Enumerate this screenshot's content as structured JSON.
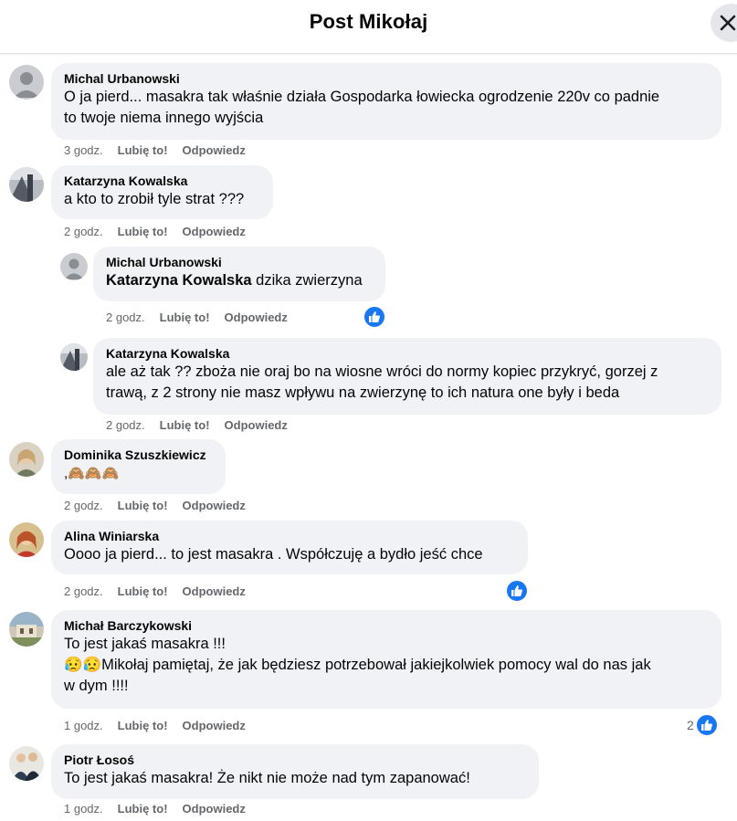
{
  "header": {
    "title": "Post Mikołaj"
  },
  "actions": {
    "like": "Lubię to!",
    "reply": "Odpowiedz"
  },
  "comments": [
    {
      "author": "Michal Urbanowski",
      "line1": "O ja pierd... masakra tak właśnie działa Gospodarka łowiecka ogrodzenie 220v co padnie",
      "line2": "to twoje niema innego wyjścia",
      "time": "3 godz."
    },
    {
      "author": "Katarzyna Kowalska",
      "line1": "a kto to zrobił tyle strat ???",
      "time": "2 godz."
    },
    {
      "author": "Michal Urbanowski",
      "mention": "Katarzyna Kowalska",
      "line1": " dzika zwierzyna",
      "time": "2 godz.",
      "likes": ""
    },
    {
      "author": "Katarzyna Kowalska",
      "line1": "ale aż tak ?? zboża nie oraj bo na wiosne wróci do normy kopiec przykryć, gorzej z",
      "line2": "trawą, z 2 strony nie masz wpływu na zwierzynę to ich natura one były i beda",
      "time": "2 godz."
    },
    {
      "author": "Dominika Szuszkiewicz",
      "line1": ",🙈🙈🙈",
      "time": "2 godz."
    },
    {
      "author": "Alina Winiarska",
      "line1": "Oooo ja pierd... to jest masakra . Współczuję a bydło jeść chce",
      "time": "2 godz."
    },
    {
      "author": "Michał Barczykowski",
      "line1": "To jest jakaś masakra !!!",
      "line2": "😥😥Mikołaj pamiętaj, że jak będziesz potrzebował jakiejkolwiek pomocy wal do nas jak",
      "line3": "w dym !!!!",
      "time": "1 godz.",
      "likes": "2"
    },
    {
      "author": "Piotr Łosoś",
      "line1": "To jest jakaś masakra! Że nikt nie może nad tym zapanować!",
      "time": "1 godz."
    }
  ],
  "colors": {
    "bubble": "#f0f2f5",
    "like_blue": "#1877f2",
    "meta": "#65676b"
  }
}
